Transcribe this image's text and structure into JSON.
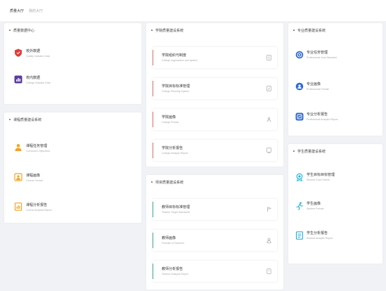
{
  "tabs": [
    "质量大厅",
    "我的大厅"
  ],
  "quality_center": {
    "title": "质量数据中心",
    "items": [
      {
        "label": "校外数据",
        "sub": "Quality Indicator Data",
        "icon": "shield-icon"
      },
      {
        "label": "校内数据",
        "sub": "College Indicator Data",
        "icon": "chart-icon"
      }
    ]
  },
  "course_system": {
    "title": "课程质量建设系统",
    "items": [
      {
        "label": "课程任务管理",
        "sub": "Curriculum Objectives",
        "icon": "person-icon"
      },
      {
        "label": "课程画像",
        "sub": "Course Portrait",
        "icon": "portrait-icon"
      },
      {
        "label": "课程分析报告",
        "sub": "Course Analysis Report",
        "icon": "report-icon"
      }
    ]
  },
  "college_system": {
    "title": "学院质量建设系统",
    "items": [
      {
        "label": "学院组织与制度",
        "sub": "College organization and system",
        "action_icon": "document-icon"
      },
      {
        "label": "学院目标标准管理",
        "sub": "College Planning System",
        "action_icon": "edit-icon"
      },
      {
        "label": "学院画像",
        "sub": "College Portrait",
        "action_icon": "portrait-icon"
      },
      {
        "label": "学院分析报告",
        "sub": "College Analysis Report",
        "action_icon": "report-icon"
      }
    ]
  },
  "teacher_system": {
    "title": "师资质量建设系统",
    "items": [
      {
        "label": "教师目标标准管理",
        "sub": "Teacher Target Standards",
        "action_icon": "flag-icon"
      },
      {
        "label": "教师画像",
        "sub": "Portraits of Teachers",
        "action_icon": "user-icon"
      },
      {
        "label": "教师分析报告",
        "sub": "Teacher Analysis Report",
        "action_icon": "report-icon"
      }
    ]
  },
  "major_system": {
    "title": "专业质量建设系统",
    "items": [
      {
        "label": "专业任务管理",
        "sub": "Professional Goal Standard",
        "icon": "target-icon"
      },
      {
        "label": "专业画像",
        "sub": "Professional Portrait",
        "icon": "portrait-icon"
      },
      {
        "label": "专业分析报告",
        "sub": "Professional Analysis Report",
        "icon": "report-icon"
      }
    ]
  },
  "student_system": {
    "title": "学生质量建设系统",
    "items": [
      {
        "label": "学生目标目标管理",
        "sub": "Student Goal Criteria",
        "icon": "medal-icon"
      },
      {
        "label": "学生画像",
        "sub": "Student Portrait",
        "icon": "runner-icon"
      },
      {
        "label": "学生分析报告",
        "sub": "Student Analysis Report",
        "icon": "report-icon"
      }
    ]
  },
  "colors": {
    "college_accent": "#e07070",
    "teacher_accent": "#3aa89a",
    "red_icon": "#e23b3b",
    "purple_icon": "#5a3d9c",
    "orange_icon": "#f2a428",
    "blue_icon": "#2f6cd6",
    "cyan_icon": "#1eb0d6"
  }
}
